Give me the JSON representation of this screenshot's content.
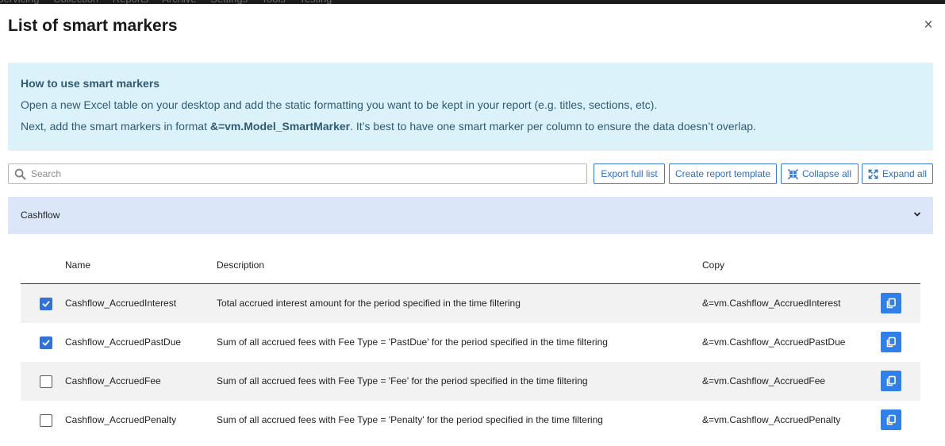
{
  "background_nav": [
    "Servicing",
    "Collection",
    "Reports",
    "Archive",
    "Settings",
    "Tools",
    "Testing"
  ],
  "modal": {
    "title": "List of smart markers",
    "close_label": "×"
  },
  "info": {
    "title": "How to use smart markers",
    "line1": "Open a new Excel table on your desktop and add the static formatting you want to be kept in your report (e.g. titles, sections, etc).",
    "line2_before": "Next, add the smart markers in format ",
    "line2_bold": "&=vm.Model_SmartMarker",
    "line2_after": ". It’s best to have one smart marker per column to ensure the data doesn’t overlap."
  },
  "search": {
    "placeholder": "Search",
    "value": ""
  },
  "toolbar": {
    "export_label": "Export full list",
    "create_template_label": "Create report template",
    "collapse_label": "Collapse all",
    "expand_label": "Expand all"
  },
  "group": {
    "label": "Cashflow",
    "expanded": true
  },
  "table": {
    "headers": {
      "name": "Name",
      "description": "Description",
      "copy": "Copy"
    },
    "rows": [
      {
        "checked": true,
        "name": "Cashflow_AccruedInterest",
        "description": "Total accrued interest amount for the period specified in the time filtering",
        "copy": "&=vm.Cashflow_AccruedInterest"
      },
      {
        "checked": true,
        "name": "Cashflow_AccruedPastDue",
        "description": "Sum of all accrued fees with Fee Type = 'PastDue' for the period specified in the time filtering",
        "copy": "&=vm.Cashflow_AccruedPastDue"
      },
      {
        "checked": false,
        "name": "Cashflow_AccruedFee",
        "description": "Sum of all accrued fees with Fee Type = 'Fee' for the period specified in the time filtering",
        "copy": "&=vm.Cashflow_AccruedFee"
      },
      {
        "checked": false,
        "name": "Cashflow_AccruedPenalty",
        "description": "Sum of all accrued fees with Fee Type = 'Penalty' for the period specified in the time filtering",
        "copy": "&=vm.Cashflow_AccruedPenalty"
      }
    ]
  },
  "icons": {
    "search": "search-icon",
    "collapse": "collapse-arrows-icon",
    "expand": "expand-arrows-icon",
    "chevron": "chevron-down-icon",
    "copy": "copy-icon",
    "check": "check-icon",
    "close": "close-icon"
  },
  "colors": {
    "accent": "#2f73d9",
    "info_bg": "#dcf2fb",
    "group_bg": "#dbe7f8",
    "row_shade": "#f2f2f2"
  }
}
